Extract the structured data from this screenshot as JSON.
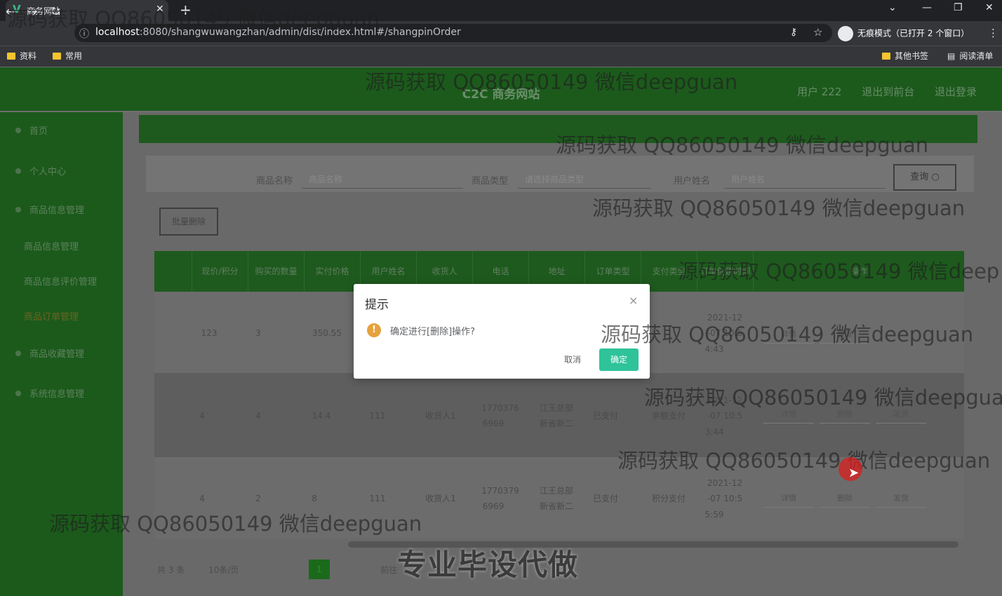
{
  "browser": {
    "tab_title": "商务网站",
    "url_host": "localhost",
    "url_rest": ":8080/shangwuwangzhan/admin/dist/index.html#/shangpinOrder",
    "incognito": "无痕模式（已打开 2 个窗口）",
    "bookmarks": [
      "资料",
      "常用"
    ],
    "other_bookmarks": "其他书签",
    "reading_list": "阅读清单"
  },
  "app": {
    "title": "C2C 商务网站",
    "user": "用户 222",
    "exit_admin": "退出到前台",
    "logout": "退出登录"
  },
  "sidebar": {
    "items": [
      "首页",
      "个人中心",
      "商品信息管理",
      "商品信息管理",
      "商品信息评价管理",
      "商品订单管理",
      "商品收藏管理",
      "系统信息管理"
    ]
  },
  "search": {
    "name_label": "商品名称",
    "name_placeholder": "商品名称",
    "type_label": "商品类型",
    "type_placeholder": "请选择商品类型",
    "user_label": "用户姓名",
    "user_placeholder": "用户姓名",
    "query_button": "查询 ○",
    "delete_button": "批量删除"
  },
  "table": {
    "headers": [
      "",
      "现价/积分",
      "购买的数量",
      "实付价格",
      "用户姓名",
      "收货人",
      "电话",
      "地址",
      "订单类型",
      "支付类型",
      "订单创建时间",
      "操作"
    ],
    "rows": [
      {
        "price": "123",
        "qty": "3",
        "paid": "350.55",
        "user": "",
        "receiver": "",
        "phone": "",
        "address": "",
        "status": "",
        "pay": "",
        "t1": "2021-12",
        "t2": "-07 10:5",
        "t3": "4:43"
      },
      {
        "price": "4",
        "qty": "4",
        "paid": "14.4",
        "user": "111",
        "receiver": "收货人1",
        "phone": "1770376",
        "phone2": "6969",
        "address": "江王总部",
        "address2": "新省新二",
        "status": "已支付",
        "pay": "余额支付",
        "t1": "2021-12",
        "t2": "-07 10:5",
        "t3": "3:44"
      },
      {
        "price": "4",
        "qty": "2",
        "paid": "8",
        "user": "111",
        "receiver": "收货人1",
        "phone": "1770379",
        "phone2": "6969",
        "address": "江王总部",
        "address2": "新省新二",
        "status": "已支付",
        "pay": "积分支付",
        "t1": "2021-12",
        "t2": "-07 10:5",
        "t3": "5:59"
      }
    ],
    "actions": [
      "详情",
      "删除",
      "发货"
    ]
  },
  "pagination": {
    "total": "共 3 条",
    "size": "10条/页",
    "page": "1",
    "goto": "前往"
  },
  "dialog": {
    "title": "提示",
    "close": "×",
    "icon": "!",
    "message": "确定进行[删除]操作?",
    "cancel": "取消",
    "ok": "确定"
  },
  "watermarks": [
    "源码获取 QQ86050149 微信deepguan",
    "源码获取 QQ86050149 微信deepguan",
    "源码获取 QQ86050149 微信deepguan",
    "源码获取 QQ86050149 微信deepguan",
    "源码获取 QQ86050149 微信deep",
    "源码获取 QQ86050149 微信deepguan",
    "源码获取 QQ86050149 微信deepgua",
    "源码获取 QQ86050149 微信deepguan",
    "源码获取 QQ86050149 微信deepguan"
  ],
  "caption": "专业毕设代做"
}
